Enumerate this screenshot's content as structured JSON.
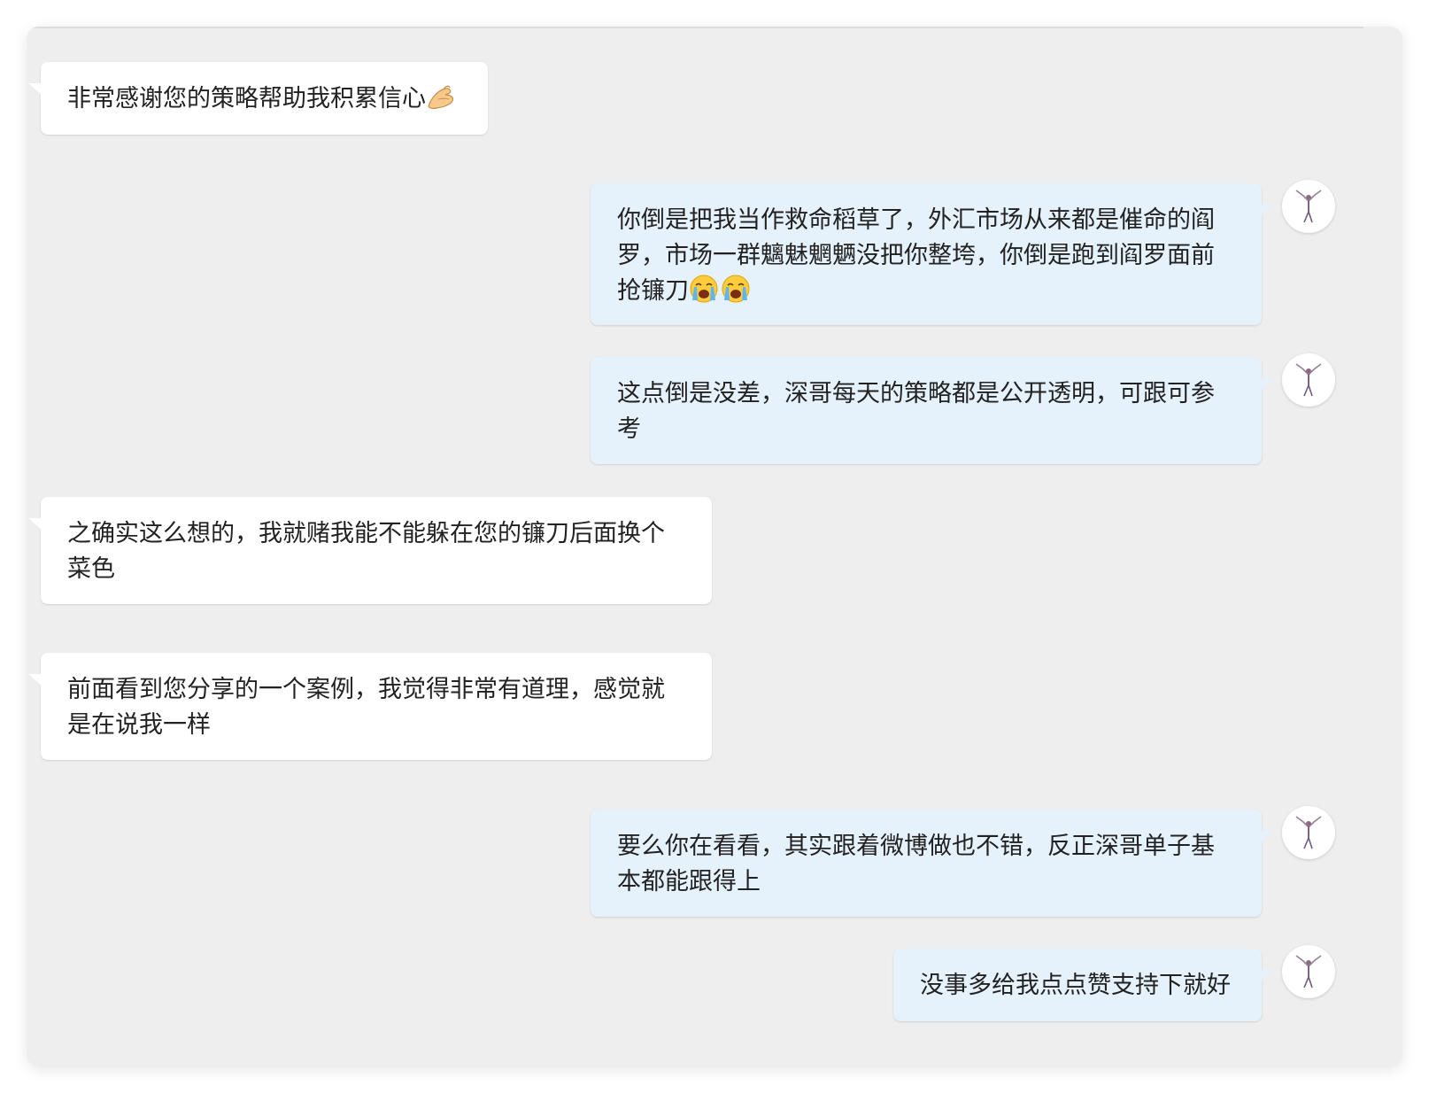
{
  "messages": [
    {
      "side": "left",
      "text": "非常感谢您的策略帮助我积累信心",
      "emoji": "pinch-hand"
    },
    {
      "side": "right",
      "text": "你倒是把我当作救命稻草了，外汇市场从来都是催命的阎罗，市场一群魑魅魍魉没把你整垮，你倒是跑到阎罗面前抢镰刀",
      "emoji": "crying-faces"
    },
    {
      "side": "right",
      "text": "这点倒是没差，深哥每天的策略都是公开透明，可跟可参考"
    },
    {
      "side": "left",
      "text": "之确实这么想的，我就赌我能不能躲在您的镰刀后面换个菜色"
    },
    {
      "side": "left",
      "text": "前面看到您分享的一个案例，我觉得非常有道理，感觉就是在说我一样"
    },
    {
      "side": "right",
      "text": "要么你在看看，其实跟着微博做也不错，反正深哥单子基本都能跟得上"
    },
    {
      "side": "right",
      "text": "没事多给我点点赞支持下就好"
    }
  ],
  "colors": {
    "panel_bg": "#eeeeee",
    "bubble_left": "#ffffff",
    "bubble_right": "#e5f1fb",
    "text": "#222222"
  }
}
